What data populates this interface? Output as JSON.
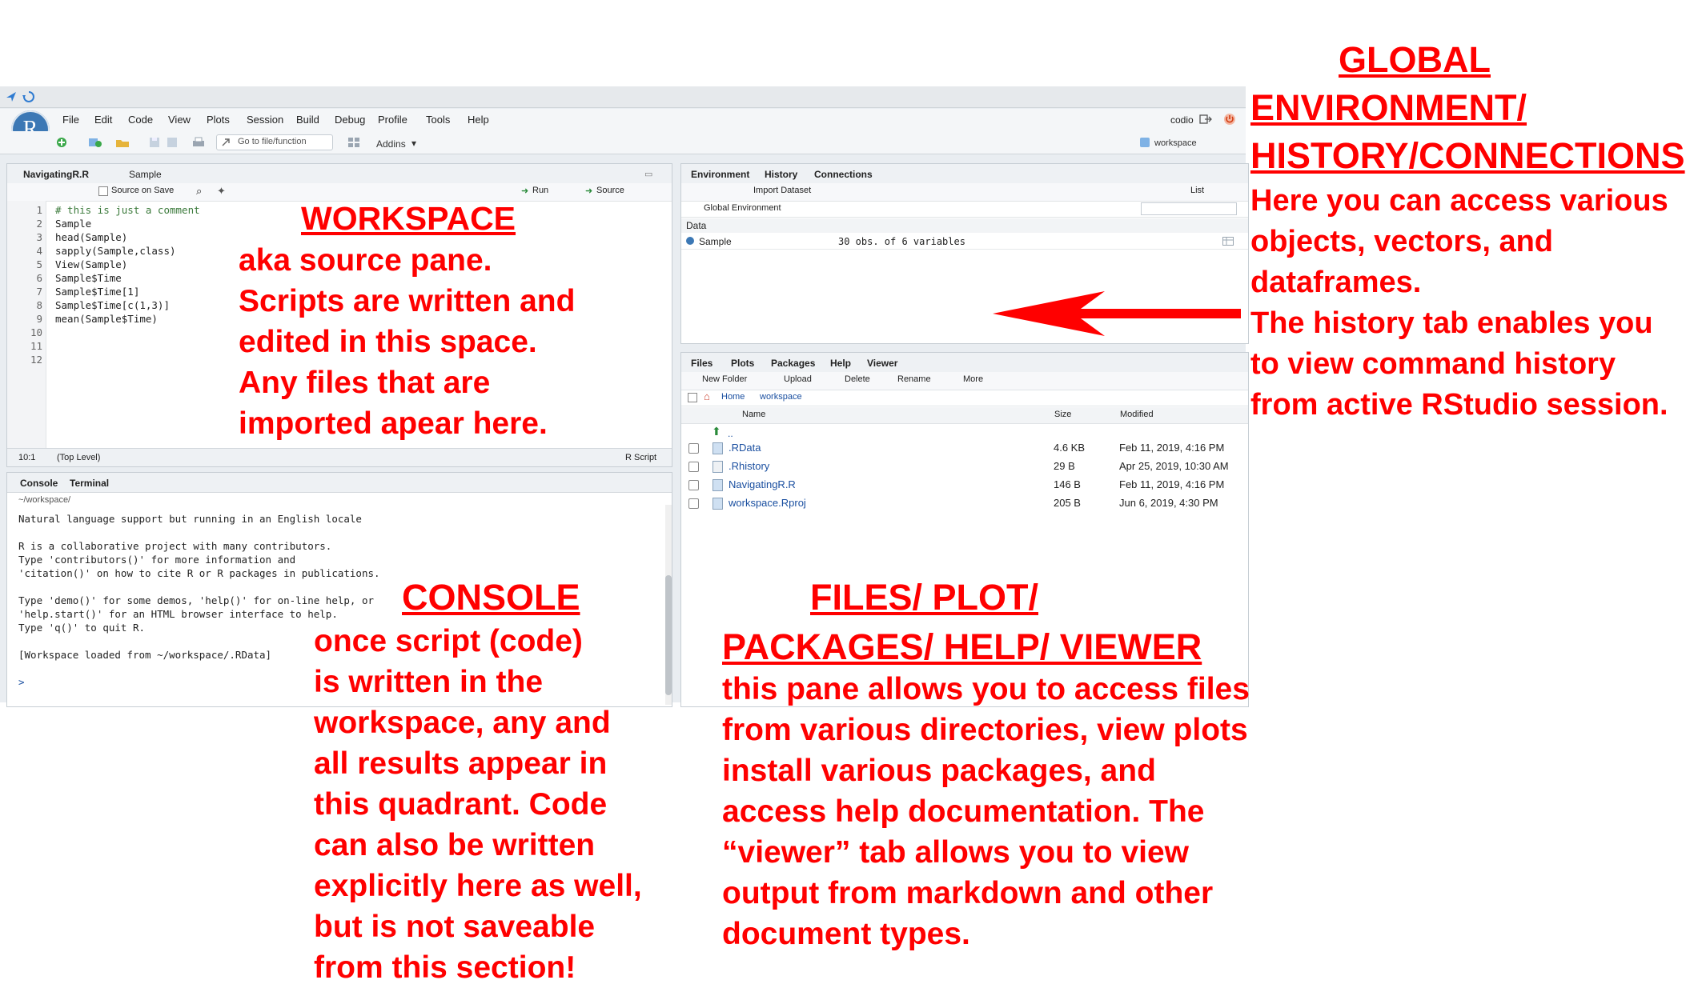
{
  "menubar": {
    "items": [
      "File",
      "Edit",
      "Code",
      "View",
      "Plots",
      "Session",
      "Build",
      "Debug",
      "Profile",
      "Tools",
      "Help"
    ],
    "user": "codio"
  },
  "toolbar": {
    "goto_placeholder": "Go to file/function",
    "addins": "Addins",
    "project": "workspace"
  },
  "source": {
    "tabs": [
      "NavigatingR.R",
      "Sample"
    ],
    "source_on_save": "Source on Save",
    "run": "Run",
    "source_btn": "Source",
    "lines": [
      "# this is just a comment",
      "Sample",
      "head(Sample)",
      "sapply(Sample,class)",
      "View(Sample)",
      "Sample$Time",
      "Sample$Time[1]",
      "Sample$Time[c(1,3)]",
      "mean(Sample$Time)",
      "",
      "",
      ""
    ],
    "line_numbers": [
      "1",
      "2",
      "3",
      "4",
      "5",
      "6",
      "7",
      "8",
      "9",
      "10",
      "11",
      "12"
    ],
    "status_pos": "10:1",
    "status_level": "(Top Level)",
    "status_type": "R Script"
  },
  "console": {
    "tabs": [
      "Console",
      "Terminal"
    ],
    "path": "~/workspace/",
    "lines": [
      "Natural language support but running in an English locale",
      "",
      "R is a collaborative project with many contributors.",
      "Type 'contributors()' for more information and",
      "'citation()' on how to cite R or R packages in publications.",
      "",
      "Type 'demo()' for some demos, 'help()' for on-line help, or",
      "'help.start()' for an HTML browser interface to help.",
      "Type 'q()' to quit R.",
      "",
      "[Workspace loaded from ~/workspace/.RData]",
      "",
      "> "
    ]
  },
  "environment": {
    "tabs": [
      "Environment",
      "History",
      "Connections"
    ],
    "import": "Import Dataset",
    "list": "List",
    "scope": "Global Environment",
    "section": "Data",
    "rows": [
      {
        "name": "Sample",
        "value": "30 obs. of 6 variables"
      }
    ]
  },
  "files": {
    "tabs": [
      "Files",
      "Plots",
      "Packages",
      "Help",
      "Viewer"
    ],
    "actions": [
      "New Folder",
      "Upload",
      "Delete",
      "Rename",
      "More"
    ],
    "crumbs": [
      "Home",
      "workspace"
    ],
    "headers": {
      "name": "Name",
      "size": "Size",
      "modified": "Modified"
    },
    "up": "..",
    "rows": [
      {
        "name": ".RData",
        "size": "4.6 KB",
        "modified": "Feb 11, 2019, 4:16 PM"
      },
      {
        "name": ".Rhistory",
        "size": "29 B",
        "modified": "Apr 25, 2019, 10:30 AM"
      },
      {
        "name": "NavigatingR.R",
        "size": "146 B",
        "modified": "Feb 11, 2019, 4:16 PM"
      },
      {
        "name": "workspace.Rproj",
        "size": "205 B",
        "modified": "Jun 6, 2019, 4:30 PM"
      }
    ]
  },
  "annotations": {
    "workspace": {
      "title": "WORKSPACE",
      "lines": [
        "aka source pane.",
        "Scripts are written and",
        "edited in this space.",
        "Any files that are",
        "imported apear here."
      ]
    },
    "console": {
      "title": "CONSOLE",
      "lines": [
        "once script (code)",
        "is written in the",
        "workspace, any and",
        "all results appear in",
        "this quadrant. Code",
        "can also be written",
        "explicitly here as well,",
        "but is not saveable",
        "from this section!"
      ]
    },
    "files": {
      "title_1": "FILES/ PLOT/",
      "title_2": "PACKAGES/ HELP/ VIEWER",
      "lines": [
        "this pane allows you to access files",
        "from various directories, view plots",
        "install various packages, and",
        "access help documentation. The",
        "“viewer” tab allows you to view",
        "output from markdown and other",
        "document types."
      ]
    },
    "env": {
      "title_1": "GLOBAL",
      "title_2": "ENVIRONMENT/",
      "title_3": "HISTORY/CONNECTIONS",
      "lines": [
        "Here you can access various",
        "objects, vectors, and",
        "dataframes.",
        "The history tab enables you",
        "to view command history",
        "from active RStudio session."
      ]
    }
  },
  "colors": {
    "annotation": "#ff0000",
    "accent": "#3c78b5"
  }
}
